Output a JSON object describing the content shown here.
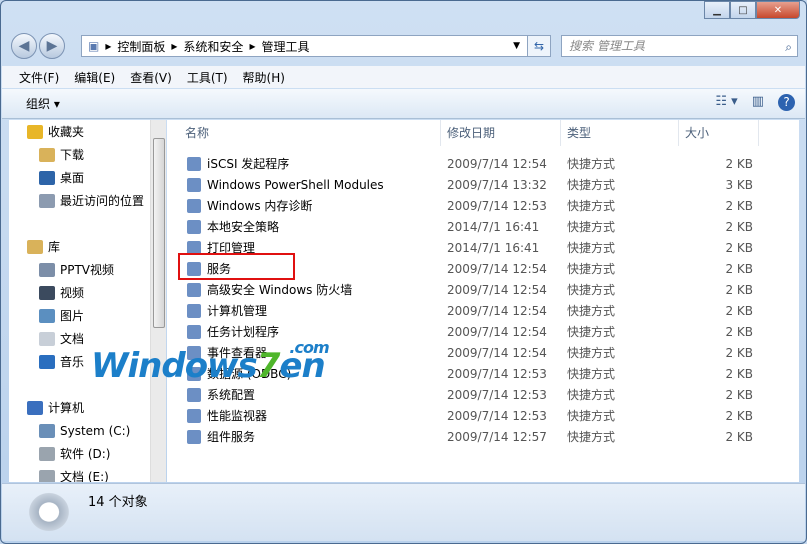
{
  "address": {
    "crumbs": [
      "控制面板",
      "系统和安全",
      "管理工具"
    ]
  },
  "search": {
    "placeholder": "搜索 管理工具"
  },
  "menu": [
    "文件(F)",
    "编辑(E)",
    "查看(V)",
    "工具(T)",
    "帮助(H)"
  ],
  "toolbar": {
    "organize": "组织 ▾"
  },
  "sidebar": {
    "items": [
      {
        "label": "收藏夹",
        "icon": "star-icon",
        "color": "#e8b628",
        "indent": 0
      },
      {
        "label": "下载",
        "icon": "download-folder-icon",
        "color": "#d9b25a",
        "indent": 1
      },
      {
        "label": "桌面",
        "icon": "desktop-icon",
        "color": "#2d64a8",
        "indent": 1
      },
      {
        "label": "最近访问的位置",
        "icon": "recent-places-icon",
        "color": "#8c9bb0",
        "indent": 1
      },
      {
        "label": "",
        "icon": "",
        "color": "",
        "indent": 0
      },
      {
        "label": "库",
        "icon": "library-icon",
        "color": "#d9b25a",
        "indent": 0
      },
      {
        "label": "PPTV视频",
        "icon": "video-library-icon",
        "color": "#7c8ea8",
        "indent": 1
      },
      {
        "label": "视频",
        "icon": "video-icon",
        "color": "#3b4a5e",
        "indent": 1
      },
      {
        "label": "图片",
        "icon": "pictures-icon",
        "color": "#5b8fc0",
        "indent": 1
      },
      {
        "label": "文档",
        "icon": "documents-icon",
        "color": "#c8cfd8",
        "indent": 1
      },
      {
        "label": "音乐",
        "icon": "music-icon",
        "color": "#2a6ebf",
        "indent": 1
      },
      {
        "label": "",
        "icon": "",
        "color": "",
        "indent": 0
      },
      {
        "label": "计算机",
        "icon": "computer-icon",
        "color": "#3a6fbe",
        "indent": 0
      },
      {
        "label": "System (C:)",
        "icon": "drive-c-icon",
        "color": "#6a8fb8",
        "indent": 1
      },
      {
        "label": "软件 (D:)",
        "icon": "drive-icon",
        "color": "#9aa4ae",
        "indent": 1
      },
      {
        "label": "文档 (E:)",
        "icon": "drive-icon",
        "color": "#9aa4ae",
        "indent": 1
      }
    ]
  },
  "columns": [
    "名称",
    "修改日期",
    "类型",
    "大小"
  ],
  "files": [
    {
      "name": "iSCSI 发起程序",
      "date": "2009/7/14 12:54",
      "type": "快捷方式",
      "size": "2 KB"
    },
    {
      "name": "Windows PowerShell Modules",
      "date": "2009/7/14 13:32",
      "type": "快捷方式",
      "size": "3 KB"
    },
    {
      "name": "Windows 内存诊断",
      "date": "2009/7/14 12:53",
      "type": "快捷方式",
      "size": "2 KB"
    },
    {
      "name": "本地安全策略",
      "date": "2014/7/1 16:41",
      "type": "快捷方式",
      "size": "2 KB"
    },
    {
      "name": "打印管理",
      "date": "2014/7/1 16:41",
      "type": "快捷方式",
      "size": "2 KB"
    },
    {
      "name": "服务",
      "date": "2009/7/14 12:54",
      "type": "快捷方式",
      "size": "2 KB"
    },
    {
      "name": "高级安全 Windows 防火墙",
      "date": "2009/7/14 12:54",
      "type": "快捷方式",
      "size": "2 KB"
    },
    {
      "name": "计算机管理",
      "date": "2009/7/14 12:54",
      "type": "快捷方式",
      "size": "2 KB"
    },
    {
      "name": "任务计划程序",
      "date": "2009/7/14 12:54",
      "type": "快捷方式",
      "size": "2 KB"
    },
    {
      "name": "事件查看器",
      "date": "2009/7/14 12:54",
      "type": "快捷方式",
      "size": "2 KB"
    },
    {
      "name": "数据源 (ODBC)",
      "date": "2009/7/14 12:53",
      "type": "快捷方式",
      "size": "2 KB"
    },
    {
      "name": "系统配置",
      "date": "2009/7/14 12:53",
      "type": "快捷方式",
      "size": "2 KB"
    },
    {
      "name": "性能监视器",
      "date": "2009/7/14 12:53",
      "type": "快捷方式",
      "size": "2 KB"
    },
    {
      "name": "组件服务",
      "date": "2009/7/14 12:57",
      "type": "快捷方式",
      "size": "2 KB"
    }
  ],
  "status": {
    "count": "14 个对象"
  },
  "watermark": {
    "text": "Windows7en",
    "suffix": ".com"
  }
}
